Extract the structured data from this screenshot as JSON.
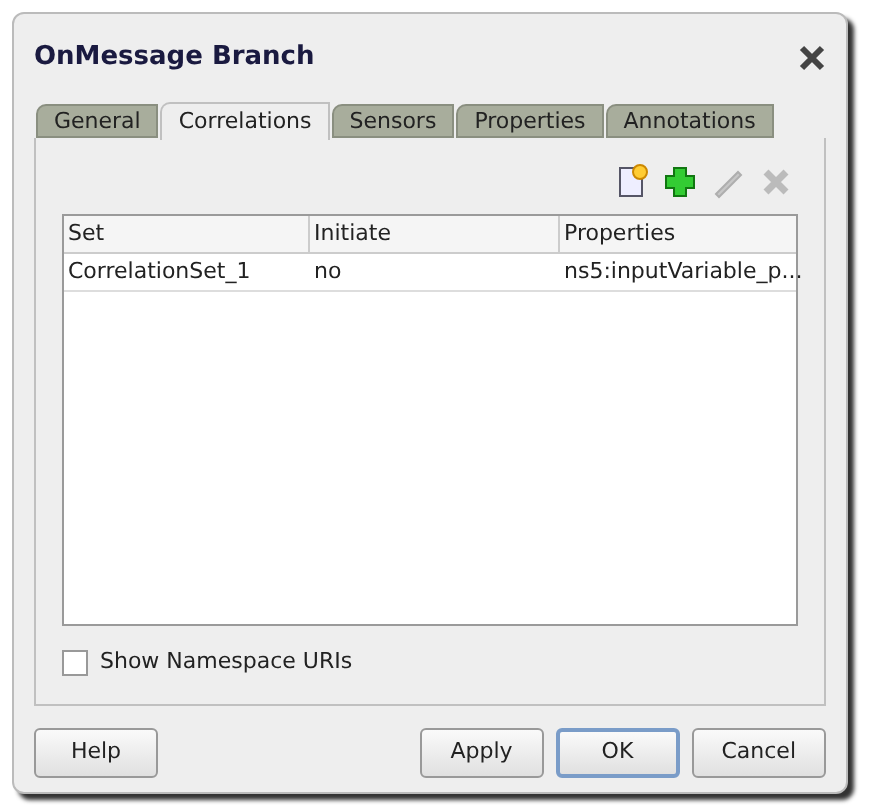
{
  "window": {
    "title": "OnMessage Branch"
  },
  "tabs": [
    {
      "label": "General",
      "selected": false
    },
    {
      "label": "Correlations",
      "selected": true
    },
    {
      "label": "Sensors",
      "selected": false
    },
    {
      "label": "Properties",
      "selected": false
    },
    {
      "label": "Annotations",
      "selected": false
    }
  ],
  "toolbar": [
    {
      "kind": "new",
      "disabled": false
    },
    {
      "kind": "add",
      "disabled": false
    },
    {
      "kind": "edit",
      "disabled": true
    },
    {
      "kind": "delete",
      "disabled": true
    }
  ],
  "table": {
    "columns": [
      "Set",
      "Initiate",
      "Properties"
    ],
    "rows": [
      [
        "CorrelationSet_1",
        "no",
        "ns5:inputVariable_p..."
      ]
    ]
  },
  "show_namespace": {
    "label": "Show Namespace URIs",
    "checked": false
  },
  "buttons": [
    {
      "label": "Help",
      "kind": "left",
      "default": false
    },
    {
      "label": "Apply",
      "kind": "right",
      "default": false
    },
    {
      "label": "OK",
      "kind": "right",
      "default": true
    },
    {
      "label": "Cancel",
      "kind": "right",
      "default": false
    }
  ]
}
